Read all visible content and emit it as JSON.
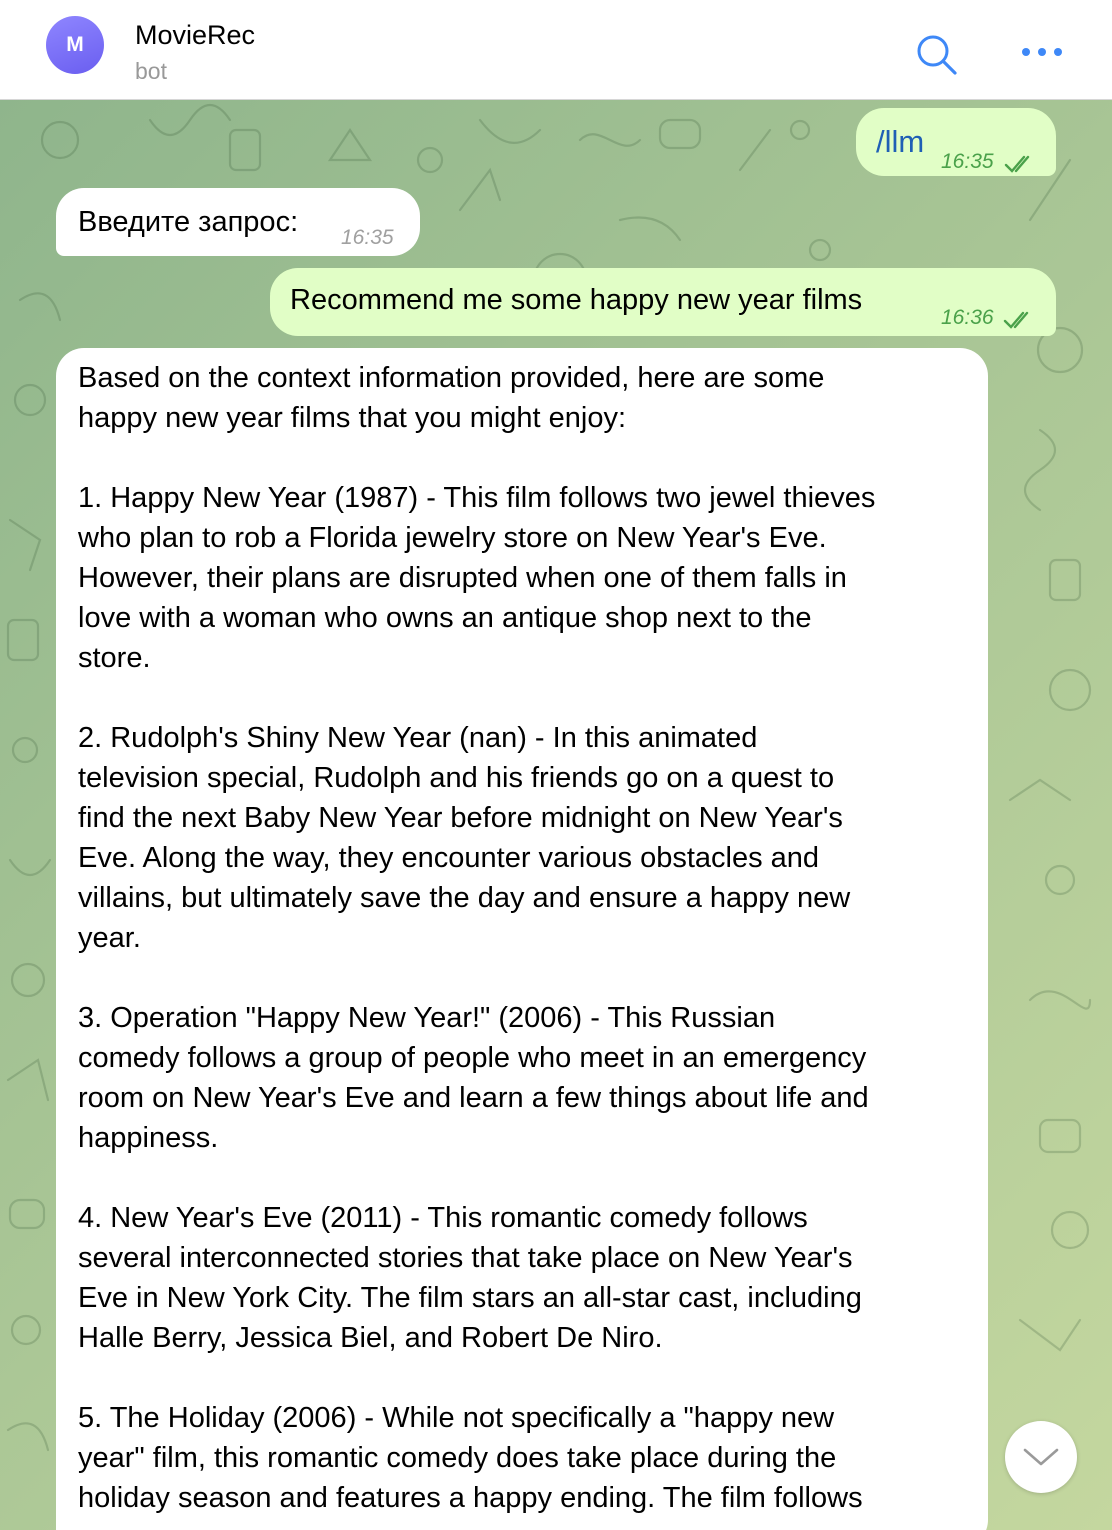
{
  "header": {
    "avatar_letter": "M",
    "title": "MovieRec",
    "subtitle": "bot"
  },
  "messages": [
    {
      "direction": "out",
      "text": "/llm",
      "time": "16:35"
    },
    {
      "direction": "in",
      "text": "Введите запрос:",
      "time": "16:35"
    },
    {
      "direction": "out",
      "text": "Recommend me some happy new year films",
      "time": "16:36"
    },
    {
      "direction": "in",
      "lines": [
        "Based on the context information provided, here are some",
        "happy new year films that you might enjoy:",
        "",
        "1. Happy New Year (1987) - This film follows two jewel thieves",
        "who plan to rob a Florida jewelry store on New Year's Eve.",
        "However, their plans are disrupted when one of them falls in",
        "love with a woman who owns an antique shop next to the",
        "store.",
        "",
        "2. Rudolph's Shiny New Year (nan) - In this animated",
        "television special, Rudolph and his friends go on a quest to",
        "find the next Baby New Year before midnight on New Year's",
        "Eve. Along the way, they encounter various obstacles and",
        "villains, but ultimately save the day and ensure a happy new",
        "year.",
        "",
        "3. Operation \"Happy New Year!\" (2006) - This Russian",
        "comedy follows a group of people who meet in an emergency",
        "room on New Year's Eve and learn a few things about life and",
        "happiness.",
        "",
        "4. New Year's Eve (2011) - This romantic comedy follows",
        "several interconnected stories that take place on New Year's",
        "Eve in New York City. The film stars an all-star cast, including",
        "Halle Berry, Jessica Biel, and Robert De Niro.",
        "",
        "5. The Holiday (2006) - While not specifically a \"happy new",
        "year\" film, this romantic comedy does take place during the",
        "holiday season and features a happy ending. The film follows"
      ]
    }
  ],
  "colors": {
    "outgoing_bubble": "#e1fec6",
    "incoming_bubble": "#ffffff",
    "accent": "#3e88f7",
    "time_out": "#4aa14a"
  },
  "icons": {
    "search": "search-icon",
    "more": "more-dots-icon",
    "read_ticks": "double-check-icon",
    "scroll_down": "chevron-down-icon"
  }
}
